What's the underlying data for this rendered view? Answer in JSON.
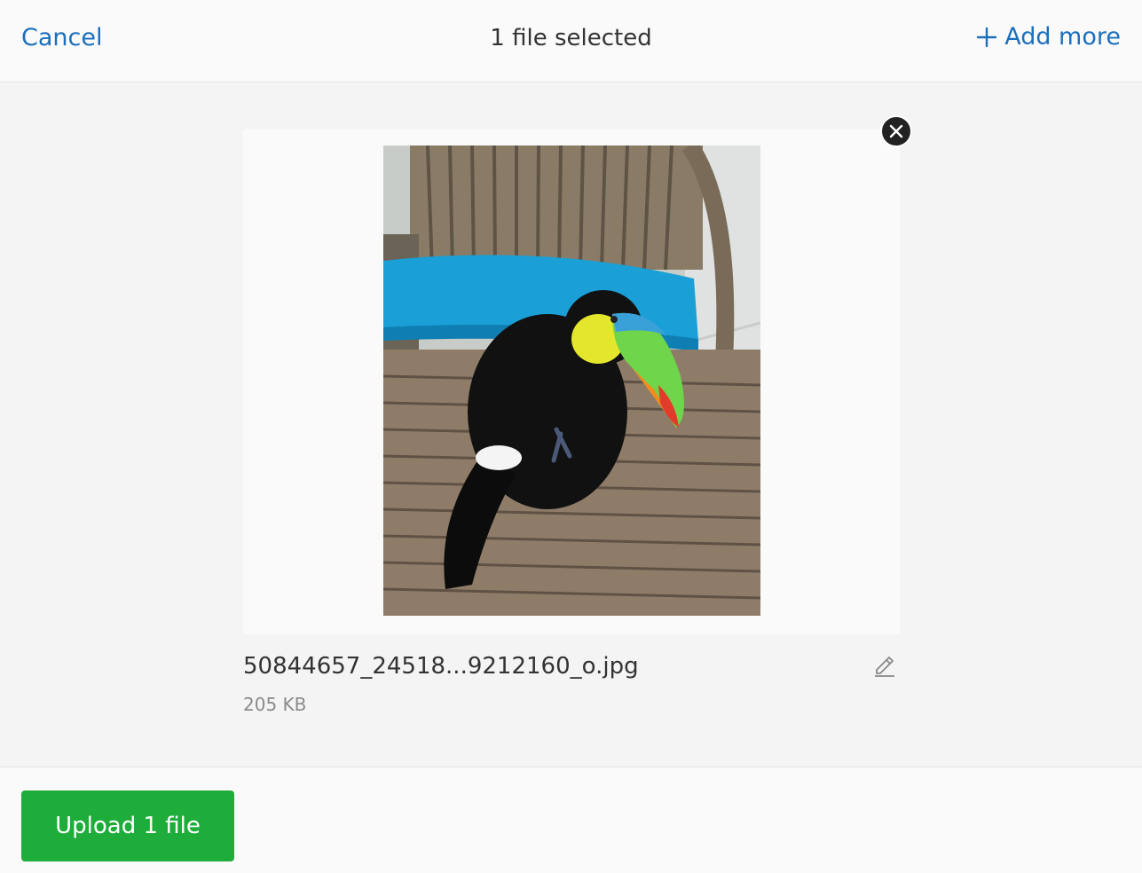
{
  "header": {
    "cancel_label": "Cancel",
    "title": "1 file selected",
    "add_more_label": "Add more"
  },
  "file": {
    "name": "50844657_24518...9212160_o.jpg",
    "size": "205 KB",
    "thumbnail_alt": "toucan on wooden chair"
  },
  "footer": {
    "upload_label": "Upload 1 file"
  },
  "colors": {
    "link": "#1c6fbd",
    "upload_button": "#1ead3a"
  },
  "icons": {
    "add": "plus-icon",
    "remove": "close-icon",
    "edit": "pencil-icon"
  }
}
